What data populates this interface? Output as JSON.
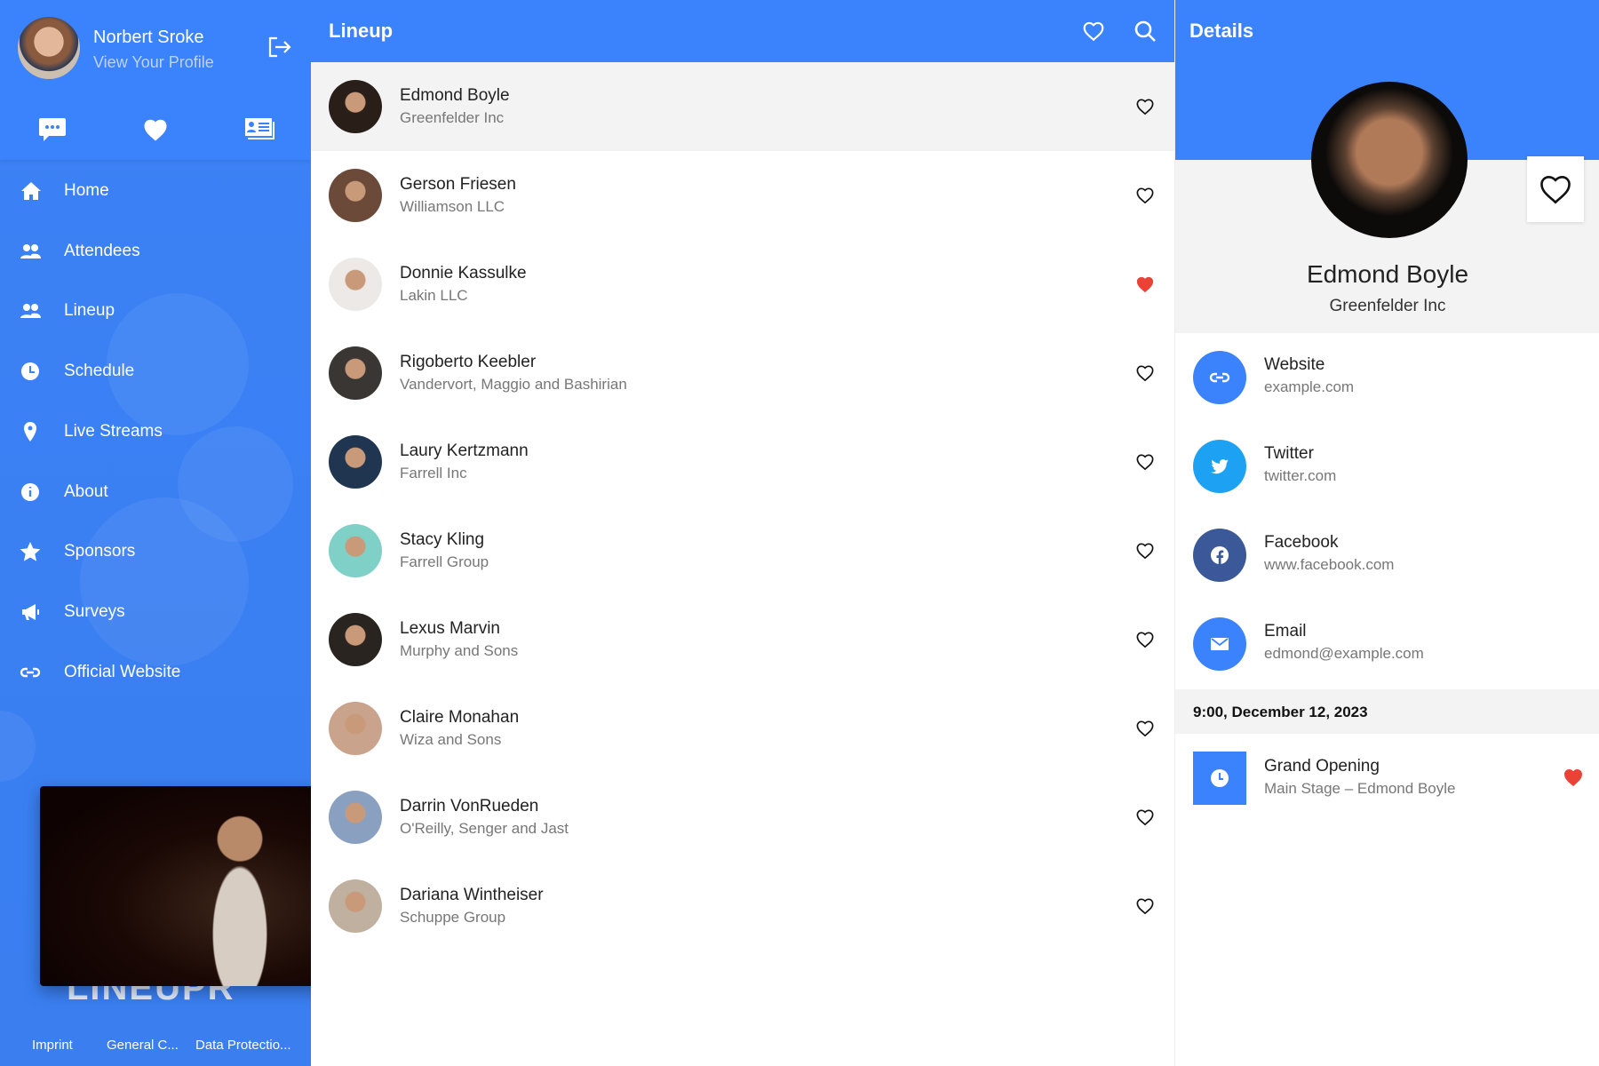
{
  "user": {
    "name": "Norbert Sroke",
    "subtitle": "View Your Profile"
  },
  "quick_icons": [
    "chat-icon",
    "heart-icon",
    "id-card-icon"
  ],
  "nav": [
    {
      "label": "Home",
      "icon": "home-icon"
    },
    {
      "label": "Attendees",
      "icon": "users-icon"
    },
    {
      "label": "Lineup",
      "icon": "users-icon"
    },
    {
      "label": "Schedule",
      "icon": "clock-icon"
    },
    {
      "label": "Live Streams",
      "icon": "map-pin-icon"
    },
    {
      "label": "About",
      "icon": "info-icon"
    },
    {
      "label": "Sponsors",
      "icon": "star-icon"
    },
    {
      "label": "Surveys",
      "icon": "megaphone-icon"
    },
    {
      "label": "Official Website",
      "icon": "link-icon"
    }
  ],
  "logo": "LINEUPR",
  "footer": [
    "Imprint",
    "General C...",
    "Data Protectio..."
  ],
  "lineup": {
    "title": "Lineup",
    "items": [
      {
        "name": "Edmond Boyle",
        "company": "Greenfelder Inc",
        "favorite": false,
        "selected": true
      },
      {
        "name": "Gerson Friesen",
        "company": "Williamson LLC",
        "favorite": false
      },
      {
        "name": "Donnie Kassulke",
        "company": "Lakin LLC",
        "favorite": true
      },
      {
        "name": "Rigoberto Keebler",
        "company": "Vandervort, Maggio and Bashirian",
        "favorite": false
      },
      {
        "name": "Laury Kertzmann",
        "company": "Farrell Inc",
        "favorite": false
      },
      {
        "name": "Stacy Kling",
        "company": "Farrell Group",
        "favorite": false
      },
      {
        "name": "Lexus Marvin",
        "company": "Murphy and Sons",
        "favorite": false
      },
      {
        "name": "Claire Monahan",
        "company": "Wiza and Sons",
        "favorite": false
      },
      {
        "name": "Darrin VonRueden",
        "company": "O'Reilly, Senger and Jast",
        "favorite": false
      },
      {
        "name": "Dariana Wintheiser",
        "company": "Schuppe Group",
        "favorite": false
      }
    ]
  },
  "details": {
    "title": "Details",
    "name": "Edmond Boyle",
    "company": "Greenfelder Inc",
    "links": [
      {
        "label": "Website",
        "value": "example.com",
        "icon": "link-icon",
        "color": "#3b82fd"
      },
      {
        "label": "Twitter",
        "value": "twitter.com",
        "icon": "twitter-icon",
        "color": "#1da1f2"
      },
      {
        "label": "Facebook",
        "value": "www.facebook.com",
        "icon": "facebook-icon",
        "color": "#3b5998"
      },
      {
        "label": "Email",
        "value": "edmond@example.com",
        "icon": "mail-icon",
        "color": "#3b82fd"
      }
    ],
    "date": "9:00, December 12, 2023",
    "event": {
      "title": "Grand Opening",
      "subtitle": "Main Stage – Edmond Boyle",
      "favorite": true
    }
  },
  "colors": {
    "primary": "#3b82fd",
    "favorite": "#ea4335"
  }
}
